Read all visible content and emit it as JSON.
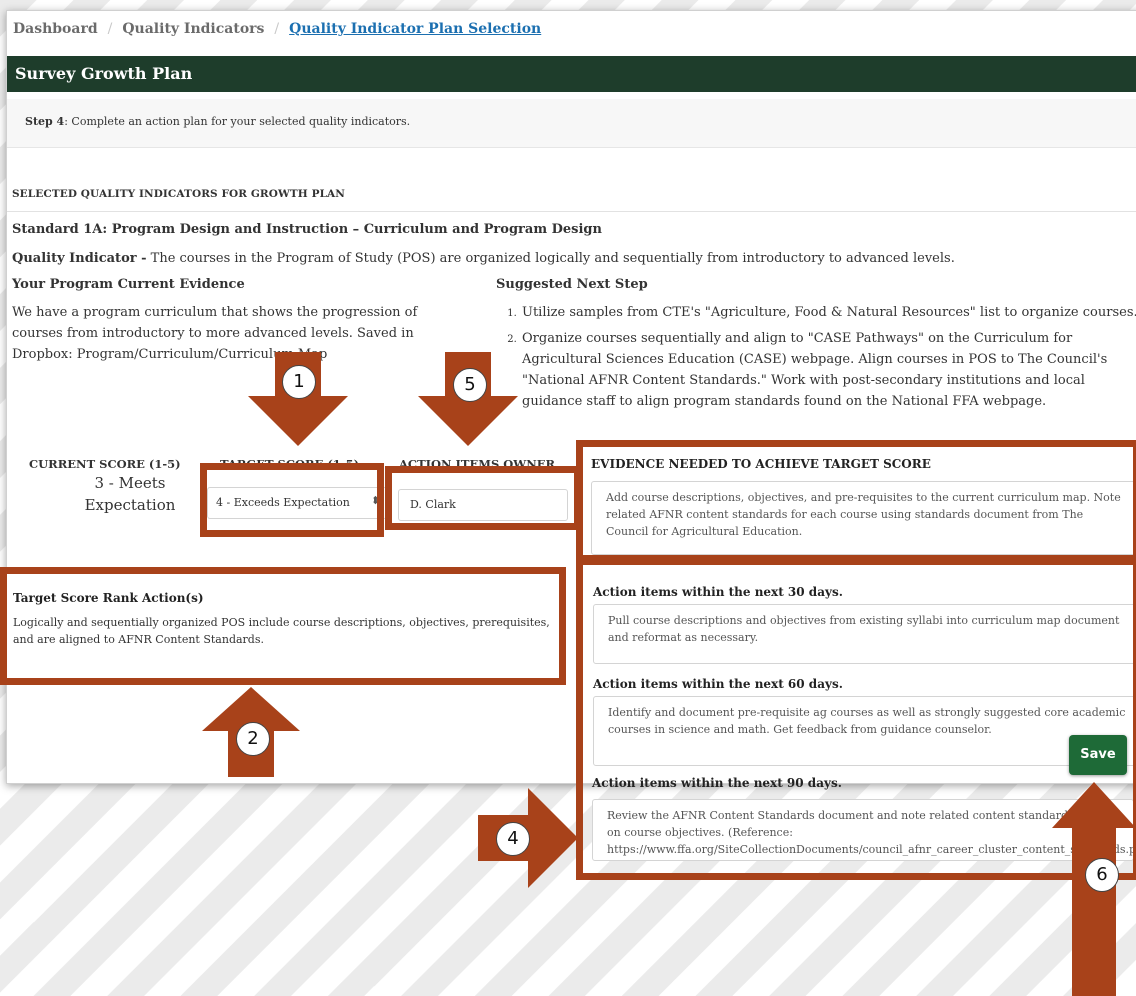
{
  "breadcrumb": {
    "item1": "Dashboard",
    "item2": "Quality Indicators",
    "item3": "Quality Indicator Plan Selection"
  },
  "page_title": "Survey Growth Plan",
  "step": {
    "label": "Step 4",
    "text": ": Complete an action plan for your selected quality indicators."
  },
  "section_heading": "SELECTED QUALITY INDICATORS FOR GROWTH PLAN",
  "standard": "Standard 1A: Program Design and Instruction – Curriculum and Program Design",
  "quality_indicator": {
    "label": "Quality Indicator -",
    "text": " The courses in the Program of Study (POS) are organized logically and sequentially from introductory to advanced levels."
  },
  "evidence": {
    "heading": "Your Program Current Evidence",
    "text": "We have a program curriculum that shows the progression of courses from introductory to more advanced levels. Saved in Dropbox: Program/Curriculum/Curriculum Map"
  },
  "next_step": {
    "heading": "Suggested Next Step",
    "items": [
      "Utilize samples from CTE's \"Agriculture, Food & Natural Resources\" list to organize courses.",
      "Organize courses sequentially and align to \"CASE Pathways\" on the Curriculum for Agricultural Sciences Education (CASE) webpage. Align courses in POS to The Council's \"National AFNR Content Standards.\" Work with post-secondary institutions and local guidance staff to align program standards found on the National FFA webpage."
    ]
  },
  "scores": {
    "current_heading": "CURRENT SCORE (1-5)",
    "current_value": "3 - Meets Expectation",
    "target_heading": "TARGET SCORE (1-5)",
    "target_value": "4 - Exceeds Expectation",
    "owner_heading": "ACTION ITEMS OWNER",
    "owner_value": "D. Clark"
  },
  "target_action": {
    "heading": "Target Score Rank Action(s)",
    "text": "Logically and sequentially organized POS include course descriptions, objectives, prerequisites, and are aligned to AFNR Content Standards."
  },
  "evidence_needed": {
    "heading": "EVIDENCE NEEDED TO ACHIEVE TARGET SCORE",
    "text": "Add course descriptions, objectives,  and pre-requisites to the current curriculum map. Note related AFNR content standards for each course using standards document from The Council for Agricultural Education."
  },
  "actions": {
    "d30_heading": "Action items within the next 30 days.",
    "d30_text": "Pull course descriptions and objectives from existing syllabi into curriculum map document and reformat as necessary.",
    "d60_heading": "Action items within the next 60 days.",
    "d60_text": "Identify and document pre-requisite ag courses as well as strongly suggested core academic courses in science and math. Get feedback from guidance counselor.",
    "d90_heading": "Action items within the next 90 days.",
    "d90_text": "Review the AFNR Content Standards document and note related content standards based on course objectives. (Reference: https://www.ffa.org/SiteCollectionDocuments/council_afnr_career_cluster_content_standards.pdf)"
  },
  "save_label": "Save",
  "callouts": {
    "n1": "1",
    "n2": "2",
    "n4": "4",
    "n5": "5",
    "n6": "6"
  },
  "colors": {
    "header_green": "#1e3d2b",
    "save_green": "#1e6a37",
    "callout_orange": "#a8421a",
    "link_blue": "#1b6fb0"
  }
}
